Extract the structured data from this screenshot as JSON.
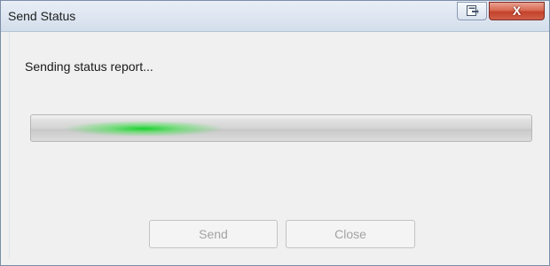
{
  "window": {
    "title": "Send Status",
    "close_glyph": "X"
  },
  "status": {
    "message": "Sending status report...",
    "progress_state": "indeterminate (marquee)",
    "progress_color": "#22cc33"
  },
  "buttons": {
    "send_label": "Send",
    "close_label": "Close",
    "send_enabled": false,
    "close_enabled": false
  },
  "icons": {
    "restore": "window-restore-icon",
    "close": "window-close-icon"
  }
}
